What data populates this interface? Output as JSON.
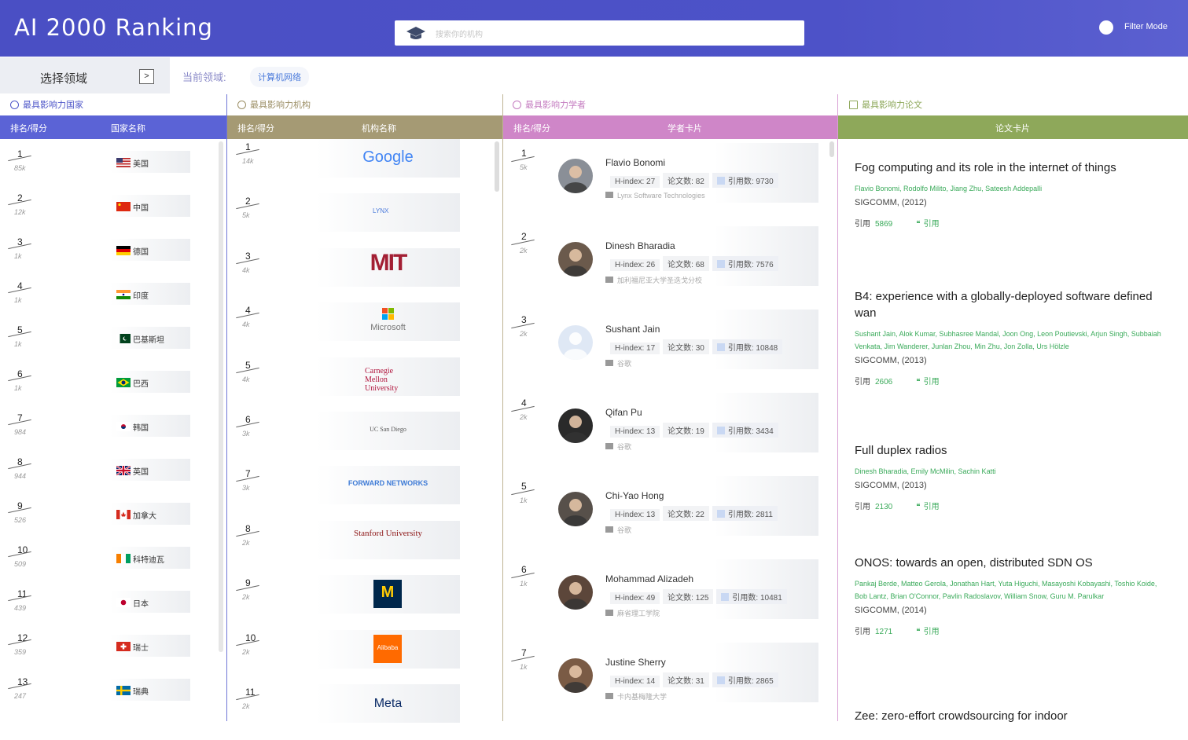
{
  "header": {
    "title": "AI 2000 Ranking",
    "search_placeholder": "搜索你的机构",
    "filter_label": "Filter Mode"
  },
  "field": {
    "label": "选择领域",
    "expand": ">",
    "current_label": "当前领域:",
    "current_value": "计算机网络"
  },
  "columns": {
    "countries": {
      "title": "最具影响力国家",
      "h1": "排名/得分",
      "h2": "国家名称"
    },
    "institutions": {
      "title": "最具影响力机构",
      "h1": "排名/得分",
      "h2": "机构名称"
    },
    "scholars": {
      "title": "最具影响力学者",
      "h1": "排名/得分",
      "h2": "学者卡片"
    },
    "papers": {
      "title": "最具影响力论文",
      "h2": "论文卡片"
    }
  },
  "countries": [
    {
      "rank": "1",
      "score": "85k",
      "name": "美国",
      "flag": "us"
    },
    {
      "rank": "2",
      "score": "12k",
      "name": "中国",
      "flag": "cn"
    },
    {
      "rank": "3",
      "score": "1k",
      "name": "德国",
      "flag": "de"
    },
    {
      "rank": "4",
      "score": "1k",
      "name": "印度",
      "flag": "in"
    },
    {
      "rank": "5",
      "score": "1k",
      "name": "巴基斯坦",
      "flag": "pk"
    },
    {
      "rank": "6",
      "score": "1k",
      "name": "巴西",
      "flag": "br"
    },
    {
      "rank": "7",
      "score": "984",
      "name": "韩国",
      "flag": "kr"
    },
    {
      "rank": "8",
      "score": "944",
      "name": "英国",
      "flag": "gb"
    },
    {
      "rank": "9",
      "score": "526",
      "name": "加拿大",
      "flag": "ca"
    },
    {
      "rank": "10",
      "score": "509",
      "name": "科特迪瓦",
      "flag": "ci"
    },
    {
      "rank": "11",
      "score": "439",
      "name": "日本",
      "flag": "jp"
    },
    {
      "rank": "12",
      "score": "359",
      "name": "瑞士",
      "flag": "ch"
    },
    {
      "rank": "13",
      "score": "247",
      "name": "瑞典",
      "flag": "se"
    }
  ],
  "institutions": [
    {
      "rank": "1",
      "score": "14k",
      "logo": "Google"
    },
    {
      "rank": "2",
      "score": "5k",
      "logo": "LYNX"
    },
    {
      "rank": "3",
      "score": "4k",
      "logo": "MIT"
    },
    {
      "rank": "4",
      "score": "4k",
      "logo": "Microsoft"
    },
    {
      "rank": "5",
      "score": "4k",
      "logo": "Carnegie Mellon University"
    },
    {
      "rank": "6",
      "score": "3k",
      "logo": "UC San Diego"
    },
    {
      "rank": "7",
      "score": "3k",
      "logo": "FORWARD NETWORKS"
    },
    {
      "rank": "8",
      "score": "2k",
      "logo": "Stanford University"
    },
    {
      "rank": "9",
      "score": "2k",
      "logo": "M"
    },
    {
      "rank": "10",
      "score": "2k",
      "logo": "Alibaba"
    },
    {
      "rank": "11",
      "score": "2k",
      "logo": "Meta"
    }
  ],
  "scholars": [
    {
      "rank": "1",
      "score": "5k",
      "name": "Flavio Bonomi",
      "hindex": "27",
      "papers": "82",
      "cites": "9730",
      "affil": "Lynx Software Technologies"
    },
    {
      "rank": "2",
      "score": "2k",
      "name": "Dinesh Bharadia",
      "hindex": "26",
      "papers": "68",
      "cites": "7576",
      "affil": "加利福尼亚大学圣迭戈分校"
    },
    {
      "rank": "3",
      "score": "2k",
      "name": "Sushant Jain",
      "hindex": "17",
      "papers": "30",
      "cites": "10848",
      "affil": "谷歌"
    },
    {
      "rank": "4",
      "score": "2k",
      "name": "Qifan Pu",
      "hindex": "13",
      "papers": "19",
      "cites": "3434",
      "affil": "谷歌"
    },
    {
      "rank": "5",
      "score": "1k",
      "name": "Chi-Yao Hong",
      "hindex": "13",
      "papers": "22",
      "cites": "2811",
      "affil": "谷歌"
    },
    {
      "rank": "6",
      "score": "1k",
      "name": "Mohammad Alizadeh",
      "hindex": "49",
      "papers": "125",
      "cites": "10481",
      "affil": "麻省理工学院"
    },
    {
      "rank": "7",
      "score": "1k",
      "name": "Justine Sherry",
      "hindex": "14",
      "papers": "31",
      "cites": "2865",
      "affil": "卡内基梅隆大学"
    }
  ],
  "labels": {
    "hindex": "H-index:",
    "papers": "论文数:",
    "cites": "引用数:",
    "cite": "引用",
    "cite_btn": "引用"
  },
  "papers": [
    {
      "title": "Fog computing and its role in the internet of things",
      "authors": "Flavio Bonomi, Rodolfo Milito, Jiang Zhu, Sateesh Addepalli",
      "venue": "SIGCOMM, (2012)",
      "cites": "5869"
    },
    {
      "title": "B4: experience with a globally-deployed software defined wan",
      "authors": "Sushant Jain, Alok Kumar, Subhasree Mandal, Joon Ong, Leon Poutievski, Arjun Singh, Subbaiah Venkata, Jim Wanderer, Junlan Zhou, Min Zhu, Jon Zolla, Urs Hölzle",
      "venue": "SIGCOMM, (2013)",
      "cites": "2606"
    },
    {
      "title": "Full duplex radios",
      "authors": "Dinesh Bharadia, Emily McMilin, Sachin Katti",
      "venue": "SIGCOMM, (2013)",
      "cites": "2130"
    },
    {
      "title": "ONOS: towards an open, distributed SDN OS",
      "authors": "Pankaj Berde, Matteo Gerola, Jonathan Hart, Yuta Higuchi, Masayoshi Kobayashi, Toshio Koide, Bob Lantz, Brian O'Connor, Pavlin Radoslavov, William Snow, Guru M. Parulkar",
      "venue": "SIGCOMM, (2014)",
      "cites": "1271"
    },
    {
      "title": "Zee: zero-effort crowdsourcing for indoor",
      "authors": "",
      "venue": "",
      "cites": ""
    }
  ],
  "colors": {
    "header": "#4a4fc4",
    "countries_band": "#5b63d6",
    "institutions_band": "#a59a74",
    "scholars_band": "#cf86c8",
    "papers_band": "#8ea85a",
    "green": "#3aaa5a"
  }
}
